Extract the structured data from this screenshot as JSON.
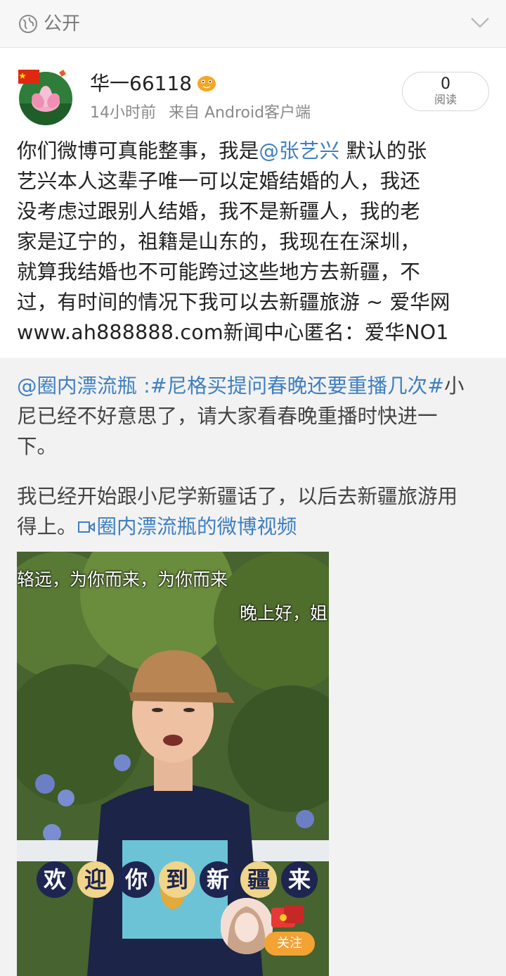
{
  "topbar": {
    "visibility": "公开"
  },
  "post": {
    "username": "华一66118",
    "time": "14小时前",
    "source": "来自 Android客户端",
    "read_count": "0",
    "read_label": "阅读",
    "text": {
      "line1_pre": "你们微博可真能整事，我是",
      "mention": "@张艺兴",
      "line1_post": " 默认的张",
      "line2": "艺兴本人这辈子唯一可以定婚结婚的人，我还",
      "line3": "没考虑过跟别人结婚，我不是新疆人，我的老",
      "line4": "家是辽宁的，祖籍是山东的，我现在在深圳，",
      "line5": "就算我结婚也不可能跨过这些地方去新疆，不",
      "line6": "过，有时间的情况下我可以去新疆旅游 ~ 爱华网",
      "line7": "www.ah888888.com新闻中心匿名：爱华NO1"
    }
  },
  "repost": {
    "mention": "@圈内漂流瓶",
    "sep": " :",
    "hashtag": "#尼格买提问春晚还要重播几次#",
    "line1_tail": "小",
    "line2": "尼已经不好意思了，请大家看春晚重播时快进一",
    "line3": "下。",
    "line4": "我已经开始跟小尼学新疆话了，以后去新疆旅游用",
    "line5_pre": "得上。",
    "video_link": "圈内漂流瓶的微博视频",
    "video": {
      "subtitle_top": "辂远，为你而来，为你而来",
      "subtitle_right": "晚上好，姐",
      "welcome_chars": [
        "欢",
        "迎",
        "你",
        "到",
        "新",
        "疆",
        "来"
      ],
      "follow_label": "关注"
    }
  },
  "colors": {
    "link": "#3f7fc1",
    "repost_bg": "#f2f2f2",
    "follow": "#f3a233"
  }
}
